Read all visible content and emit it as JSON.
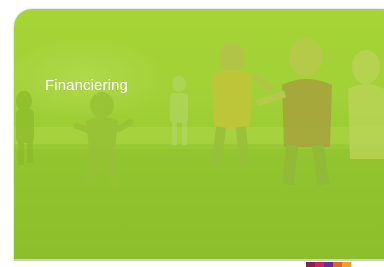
{
  "banner": {
    "caption": "Financiering"
  },
  "brand_colors": {
    "overlay": "#a1d136",
    "strip": [
      "#8a1f5a",
      "#d1205d",
      "#6b2c8f",
      "#e0642a",
      "#f2a11f"
    ]
  },
  "image": {
    "subject": "children-running-on-grass"
  }
}
